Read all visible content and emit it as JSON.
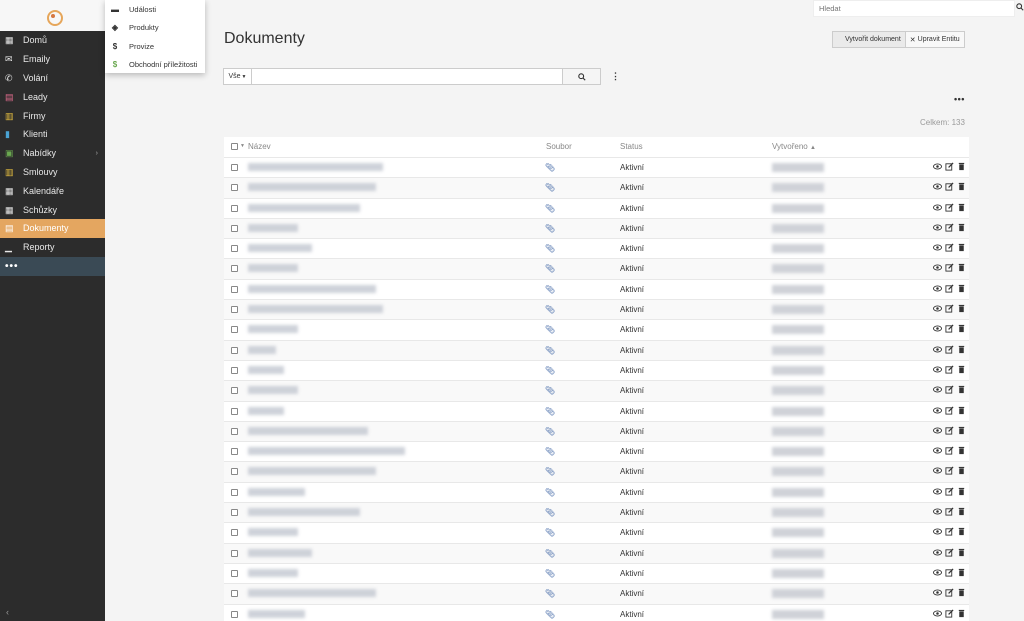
{
  "sidebar": {
    "items": [
      {
        "label": "Domů",
        "icon": "dashboard-icon",
        "color": "#e8e8e8"
      },
      {
        "label": "Emaily",
        "icon": "envelope-icon",
        "color": "#e8e8e8"
      },
      {
        "label": "Volání",
        "icon": "phone-icon",
        "color": "#e8e8e8"
      },
      {
        "label": "Leady",
        "icon": "id-card-icon",
        "color": "#e06c8d"
      },
      {
        "label": "Firmy",
        "icon": "building-icon",
        "color": "#e8c040"
      },
      {
        "label": "Klienti",
        "icon": "person-icon",
        "color": "#4aa3d4"
      },
      {
        "label": "Nabídky",
        "icon": "offer-icon",
        "color": "#6aa84f"
      },
      {
        "label": "Smlouvy",
        "icon": "contract-icon",
        "color": "#e8c040"
      },
      {
        "label": "Kalendáře",
        "icon": "calendar-icon",
        "color": "#e8e8e8"
      },
      {
        "label": "Schůzky",
        "icon": "calendar-check-icon",
        "color": "#e8e8e8"
      },
      {
        "label": "Dokumenty",
        "icon": "document-icon",
        "color": "#ffffff"
      },
      {
        "label": "Reporty",
        "icon": "chart-icon",
        "color": "#e8e8e8"
      }
    ],
    "more": "•••",
    "collapse": "‹"
  },
  "dropdown": {
    "items": [
      {
        "label": "Události",
        "icon": "event-icon",
        "glyph": "▬"
      },
      {
        "label": "Produkty",
        "icon": "box-icon",
        "glyph": "◈"
      },
      {
        "label": "Provize",
        "icon": "dollar-icon",
        "glyph": "$"
      },
      {
        "label": "Obchodní příležitosti",
        "icon": "dollar-green-icon",
        "glyph": "$"
      }
    ]
  },
  "search": {
    "placeholder": "Hledat"
  },
  "page": {
    "title": "Dokumenty",
    "create_button": "Vytvořit dokument",
    "edit_entity_button": "Upravit Entitu",
    "filter_label": "Vše",
    "more": "•••",
    "total": "Celkem: 133"
  },
  "table": {
    "headers": {
      "name": "Název",
      "file": "Soubor",
      "status": "Status",
      "created": "Vytvořeno"
    },
    "rows": [
      {
        "status": "Aktivní",
        "name_width": 135
      },
      {
        "status": "Aktivní",
        "name_width": 128
      },
      {
        "status": "Aktivní",
        "name_width": 112
      },
      {
        "status": "Aktivní",
        "name_width": 50
      },
      {
        "status": "Aktivní",
        "name_width": 64
      },
      {
        "status": "Aktivní",
        "name_width": 50
      },
      {
        "status": "Aktivní",
        "name_width": 128
      },
      {
        "status": "Aktivní",
        "name_width": 135
      },
      {
        "status": "Aktivní",
        "name_width": 50
      },
      {
        "status": "Aktivní",
        "name_width": 28
      },
      {
        "status": "Aktivní",
        "name_width": 36
      },
      {
        "status": "Aktivní",
        "name_width": 50
      },
      {
        "status": "Aktivní",
        "name_width": 36
      },
      {
        "status": "Aktivní",
        "name_width": 120
      },
      {
        "status": "Aktivní",
        "name_width": 157
      },
      {
        "status": "Aktivní",
        "name_width": 128
      },
      {
        "status": "Aktivní",
        "name_width": 57
      },
      {
        "status": "Aktivní",
        "name_width": 112
      },
      {
        "status": "Aktivní",
        "name_width": 50
      },
      {
        "status": "Aktivní",
        "name_width": 64
      },
      {
        "status": "Aktivní",
        "name_width": 50
      },
      {
        "status": "Aktivní",
        "name_width": 128
      },
      {
        "status": "Aktivní",
        "name_width": 57
      }
    ]
  }
}
